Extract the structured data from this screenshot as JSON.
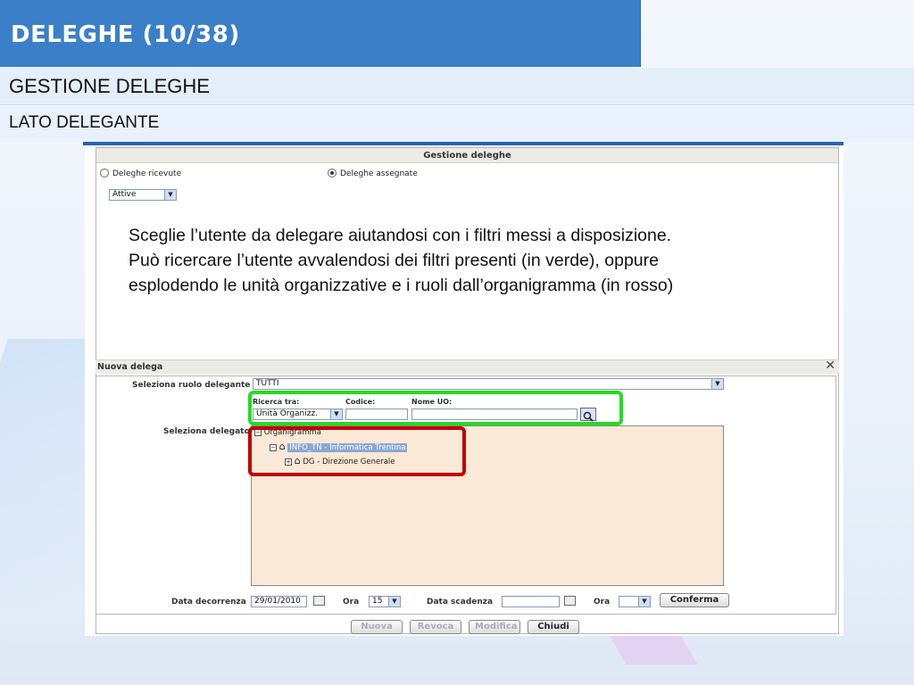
{
  "slide": {
    "title": "DELEGHE (10/38)",
    "subtitle": "GESTIONE DELEGHE",
    "section": "LATO DELEGANTE"
  },
  "panel": {
    "header": "Gestione deleghe",
    "radio_received": "Deleghe ricevute",
    "radio_assigned": "Deleghe assegnate",
    "status_select": "Attive"
  },
  "callout": {
    "line1": "Sceglie l’utente da delegare aiutandosi con i filtri messi a disposizione.",
    "line2": "Può ricercare l’utente avvalendosi dei filtri presenti (in verde), oppure",
    "line3": "esplodendo le unità organizzative e i ruoli dall’organigramma (in rosso)"
  },
  "nuova_delega": {
    "title": "Nuova delega",
    "role_label": "Seleziona ruolo delegante",
    "role_value": "TUTTI",
    "search_in_label": "Ricerca tra:",
    "search_in_value": "Unità Organizz.",
    "code_label": "Codice:",
    "name_label": "Nome UO:",
    "delegate_label": "Seleziona delegato",
    "tree": {
      "root": "Organigramma",
      "node1": "INFO_TN - Informatica Trentina",
      "node2": "DG - Direzione Generale"
    },
    "start_label": "Data decorrenza",
    "start_value": "29/01/2010",
    "hour_label": "Ora",
    "hour_value": "15",
    "end_label": "Data scadenza",
    "end_hour_label": "Ora",
    "confirm": "Conferma"
  },
  "buttons": {
    "new": "Nuova",
    "revoke": "Revoca",
    "edit": "Modifica",
    "close": "Chiudi"
  },
  "colors": {
    "title_bar": "#3b7fc8",
    "green_frame": "#22dd22",
    "red_frame": "#c00000"
  }
}
